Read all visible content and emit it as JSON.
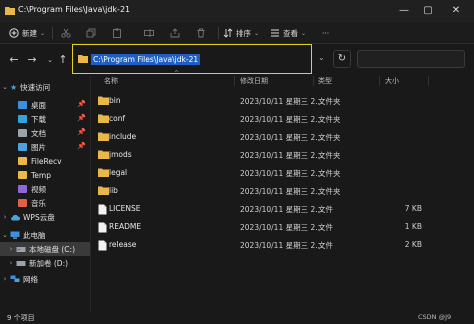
{
  "window": {
    "title": "C:\\Program Files\\Java\\jdk-21",
    "minimize": "—",
    "maximize": "▢",
    "close": "✕"
  },
  "toolbar": {
    "new_label": "新建",
    "sort_label": "排序",
    "view_label": "查看",
    "more_label": "···"
  },
  "nav": {
    "back": "←",
    "forward": "→",
    "up": "↑",
    "address_value": "C:\\Program Files\\Java\\jdk-21",
    "dropdown": "⌄",
    "refresh": "↻"
  },
  "sidebar": {
    "quick_access": "快速访问",
    "items": [
      {
        "label": "桌面",
        "pinned": true,
        "color": "#3d8fe0"
      },
      {
        "label": "下载",
        "pinned": true,
        "color": "#36a3d9"
      },
      {
        "label": "文档",
        "pinned": true,
        "color": "#9aa3ad"
      },
      {
        "label": "图片",
        "pinned": true,
        "color": "#4aa3df"
      },
      {
        "label": "FileRecv",
        "pinned": false,
        "color": "#e8b84a"
      },
      {
        "label": "Temp",
        "pinned": false,
        "color": "#e8b84a"
      },
      {
        "label": "视频",
        "pinned": false,
        "color": "#8e66d6"
      },
      {
        "label": "音乐",
        "pinned": false,
        "color": "#e0614a"
      }
    ],
    "wps": "WPS云盘",
    "this_pc": "此电脑",
    "drives": [
      {
        "label": "本地磁盘 (C:)",
        "selected": true
      },
      {
        "label": "新加卷 (D:)",
        "selected": false
      }
    ],
    "network": "网络"
  },
  "columns": {
    "name": "名称",
    "modified": "修改日期",
    "type": "类型",
    "size": "大小"
  },
  "files": [
    {
      "name": "bin",
      "date": "2023/10/11 星期三 2...",
      "type": "文件夹",
      "size": "",
      "kind": "folder"
    },
    {
      "name": "conf",
      "date": "2023/10/11 星期三 2...",
      "type": "文件夹",
      "size": "",
      "kind": "folder"
    },
    {
      "name": "include",
      "date": "2023/10/11 星期三 2...",
      "type": "文件夹",
      "size": "",
      "kind": "folder"
    },
    {
      "name": "jmods",
      "date": "2023/10/11 星期三 2...",
      "type": "文件夹",
      "size": "",
      "kind": "folder"
    },
    {
      "name": "legal",
      "date": "2023/10/11 星期三 2...",
      "type": "文件夹",
      "size": "",
      "kind": "folder"
    },
    {
      "name": "lib",
      "date": "2023/10/11 星期三 2...",
      "type": "文件夹",
      "size": "",
      "kind": "folder"
    },
    {
      "name": "LICENSE",
      "date": "2023/10/11 星期三 2...",
      "type": "文件",
      "size": "7 KB",
      "kind": "file"
    },
    {
      "name": "README",
      "date": "2023/10/11 星期三 2...",
      "type": "文件",
      "size": "1 KB",
      "kind": "file"
    },
    {
      "name": "release",
      "date": "2023/10/11 星期三 2...",
      "type": "文件",
      "size": "2 KB",
      "kind": "file"
    }
  ],
  "status": {
    "count": "9 个项目",
    "watermark": "CSDN @J9"
  },
  "colors": {
    "folder": "#e8b84a",
    "highlight_border": "#e3d21c",
    "selection": "#1f5fc3"
  }
}
